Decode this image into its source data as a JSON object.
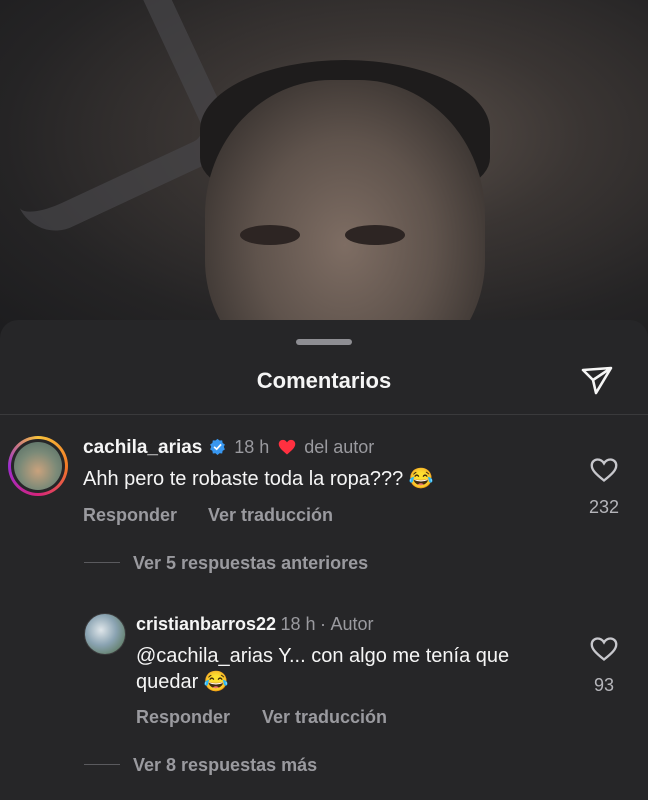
{
  "sheet": {
    "title": "Comentarios"
  },
  "comments": [
    {
      "username": "cachila_arias",
      "time": "18 h",
      "liked_by_author": "del autor",
      "text": "Ahh pero te robaste toda la ropa??? 😂",
      "reply_label": "Responder",
      "translate_label": "Ver traducción",
      "likes": "232"
    }
  ],
  "previous_replies": "Ver 5 respuestas anteriores",
  "reply": {
    "username": "cristianbarros22",
    "time": "18 h",
    "separator": "·",
    "role": "Autor",
    "text_line1": "@cachila_arias Y... con algo me tenía que",
    "text_line2": "quedar 😂",
    "reply_label": "Responder",
    "translate_label": "Ver traducción",
    "likes": "93"
  },
  "more_replies": "Ver 8 respuestas más",
  "colors": {
    "sheet_bg": "#262628",
    "secondary_text": "#9a9a9f",
    "verified_blue": "#3897f0",
    "heart_red": "#ff3040"
  },
  "icons": [
    "send-icon",
    "verified-badge-icon",
    "heart-filled-icon",
    "heart-outline-icon"
  ]
}
